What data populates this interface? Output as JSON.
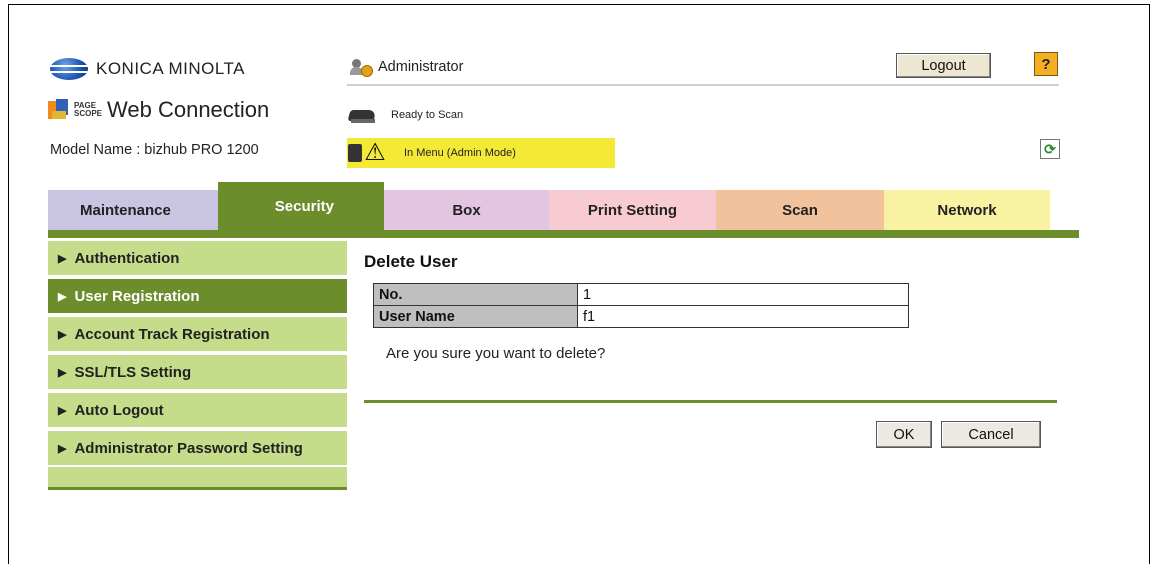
{
  "header": {
    "brand": "KONICA MINOLTA",
    "pagescope_small_line1": "PAGE",
    "pagescope_small_line2": "SCOPE",
    "app_title": "Web Connection",
    "model_label": "Model Name : bizhub PRO 1200",
    "user_role": "Administrator",
    "logout_label": "Logout",
    "help_label": "?",
    "scanner_status": "Ready to Scan",
    "mode_status": "In Menu (Admin Mode)"
  },
  "tabs": [
    {
      "label": "Maintenance"
    },
    {
      "label": "Security"
    },
    {
      "label": "Box"
    },
    {
      "label": "Print Setting"
    },
    {
      "label": "Scan"
    },
    {
      "label": "Network"
    }
  ],
  "active_tab": "Security",
  "sidebar": {
    "items": [
      {
        "label": "Authentication"
      },
      {
        "label": "User Registration"
      },
      {
        "label": "Account Track Registration"
      },
      {
        "label": "SSL/TLS Setting"
      },
      {
        "label": "Auto Logout"
      },
      {
        "label": "Administrator Password Setting"
      }
    ],
    "active_item": "User Registration"
  },
  "content": {
    "title": "Delete User",
    "rows": [
      {
        "label": "No.",
        "value": "1"
      },
      {
        "label": "User Name",
        "value": "f1"
      }
    ],
    "confirm_text": "Are you sure you want to delete?",
    "ok_label": "OK",
    "cancel_label": "Cancel"
  },
  "icons": {
    "brand_logo": "konica-minolta-globe-icon",
    "pagescope_logo": "pagescope-logo-icon",
    "admin": "administrator-icon",
    "scanner": "scanner-icon",
    "warning": "warning-icon",
    "refresh": "refresh-icon",
    "help": "help-icon"
  },
  "colors": {
    "security_green": "#6b8d2c",
    "sidebar_green": "#c5dc8b",
    "warning_yellow": "#f4ea36"
  }
}
